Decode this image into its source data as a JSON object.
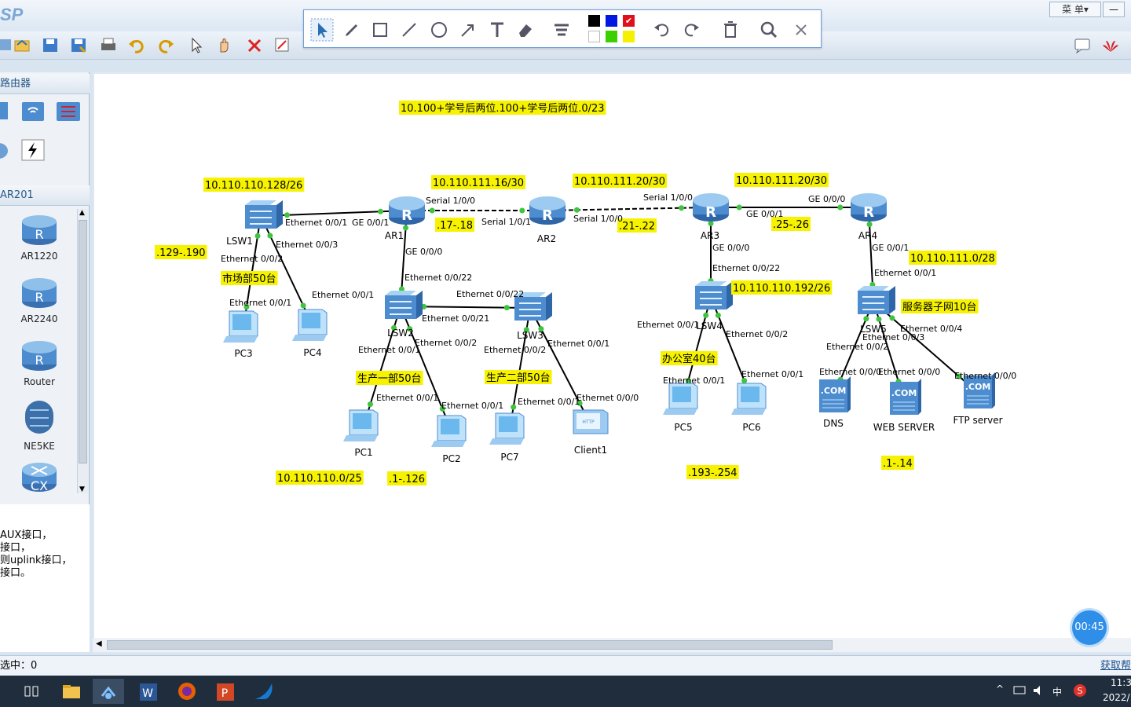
{
  "app": {
    "logo": "SP",
    "menu_label": "菜 单",
    "min_label": "—"
  },
  "left_panel": {
    "category_title": "路由器",
    "model_title": "AR201",
    "devices": [
      {
        "label": "AR1220"
      },
      {
        "label": "AR2240"
      },
      {
        "label": "Router"
      },
      {
        "label": "NE5KE"
      },
      {
        "label": "CX"
      }
    ],
    "description": "AUX接口，\n接口，\n则uplink接口，\n接口。"
  },
  "status": {
    "selected": "选中：0",
    "right_link": "获取帮"
  },
  "timer": "00:45",
  "tray": {
    "ime": "中",
    "time": "11:3",
    "date": "2022/1"
  },
  "topology": {
    "devices": [
      {
        "id": "LSW1",
        "label": "LSW1"
      },
      {
        "id": "AR1",
        "label": "AR1"
      },
      {
        "id": "AR2",
        "label": "AR2"
      },
      {
        "id": "AR3",
        "label": "AR3"
      },
      {
        "id": "AR4",
        "label": "AR4"
      },
      {
        "id": "LSW2",
        "label": "LSW2"
      },
      {
        "id": "LSW3",
        "label": "LSW3"
      },
      {
        "id": "LSW4",
        "label": "LSW4"
      },
      {
        "id": "LSW5",
        "label": "LSW5"
      },
      {
        "id": "PC3",
        "label": "PC3"
      },
      {
        "id": "PC4",
        "label": "PC4"
      },
      {
        "id": "PC1",
        "label": "PC1"
      },
      {
        "id": "PC2",
        "label": "PC2"
      },
      {
        "id": "PC7",
        "label": "PC7"
      },
      {
        "id": "Client1",
        "label": "Client1"
      },
      {
        "id": "PC5",
        "label": "PC5"
      },
      {
        "id": "PC6",
        "label": "PC6"
      },
      {
        "id": "DNS",
        "label": "DNS"
      },
      {
        "id": "WEB",
        "label": "WEB SERVER"
      },
      {
        "id": "FTP",
        "label": "FTP server"
      }
    ],
    "notes": [
      "10.100+学号后两位.100+学号后两位.0/23",
      "10.110.110.128/26",
      "10.110.111.16/30",
      "10.110.111.20/30",
      "10.110.111.20/30",
      ".129-.190",
      "市场部50台",
      ".17-.18",
      ".21-.22",
      ".25-.26",
      "10.110.111.0/28",
      "10.110.110.192/26",
      "服务器子网10台",
      "生产一部50台",
      "生产二部50台",
      "办公室40台",
      "10.110.110.0/25",
      ".1-.126",
      ".193-.254",
      ".1-.14"
    ],
    "ports": [
      "Ethernet 0/0/1",
      "GE 0/0/1",
      "Serial 1/0/0",
      "Serial 1/0/1",
      "Serial 1/0/0",
      "Serial 1/0/0",
      "GE 0/0/1",
      "GE 0/0/0",
      "Ethernet 0/0/3",
      "Ethernet 0/0/2",
      "GE 0/0/0",
      "Ethernet 0/0/22",
      "Ethernet 0/0/1",
      "Ethernet 0/0/1",
      "Ethernet 0/0/22",
      "Ethernet 0/0/21",
      "Ethernet 0/0/1",
      "Ethernet 0/0/2",
      "Ethernet 0/0/2",
      "Ethernet 0/0/1",
      "Ethernet 0/0/1",
      "Ethernet 0/0/1",
      "Ethernet 0/0/1",
      "Ethernet 0/0/0",
      "GE 0/0/0",
      "Ethernet 0/0/22",
      "Ethernet 0/0/1",
      "Ethernet 0/0/2",
      "Ethernet 0/0/1",
      "Ethernet 0/0/1",
      "GE 0/0/1",
      "Ethernet 0/0/1",
      "Ethernet 0/0/4",
      "Ethernet 0/0/3",
      "Ethernet 0/0/2",
      "Ethernet 0/0/0",
      "Ethernet 0/0/0",
      "Ethernet 0/0/0"
    ]
  }
}
